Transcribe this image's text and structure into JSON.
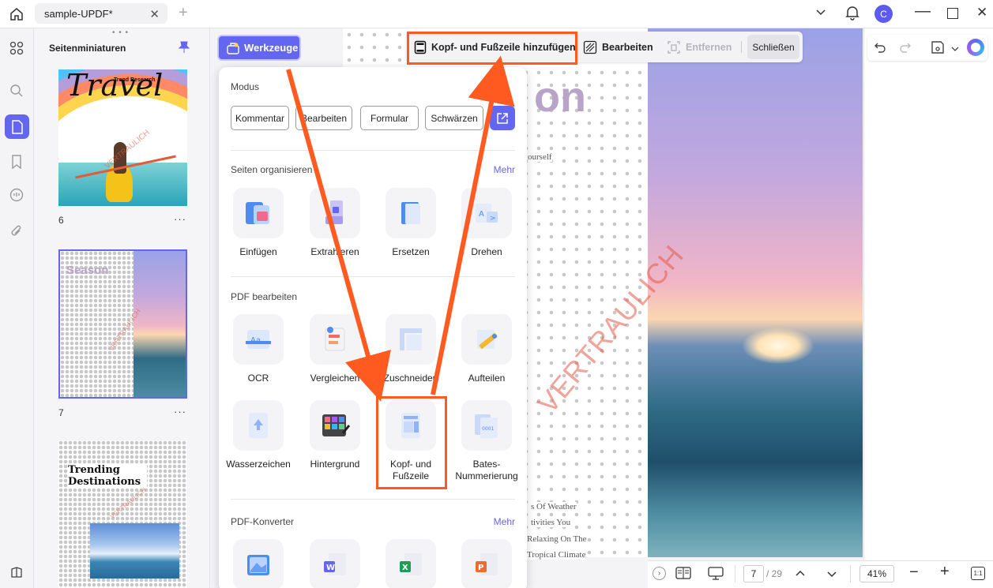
{
  "tab": {
    "title": "sample-UPDF*"
  },
  "user": {
    "initial": "C"
  },
  "thumbnail_panel": {
    "title": "Seitenminiaturen",
    "pages": [
      {
        "number": "6",
        "heading": "Travel",
        "subheading": "Trend Research",
        "watermark": "VERTRAULICH"
      },
      {
        "number": "7",
        "heading": "Season",
        "watermark": "VERTRAULICH"
      },
      {
        "number": "",
        "heading": "Trending Destinations",
        "watermark": "VERTRAULICH"
      }
    ],
    "more": "···"
  },
  "toolbar": {
    "werkzeuge": "Werkzeuge",
    "add_header_footer": "Kopf- und Fußzeile hinzufügen",
    "edit": "Bearbeiten",
    "remove": "Entfernen",
    "close": "Schließen"
  },
  "tools_menu": {
    "mode_label": "Modus",
    "modes": [
      "Kommentar",
      "Bearbeiten",
      "Formular",
      "Schwärzen"
    ],
    "sections": {
      "organize": {
        "label": "Seiten organisieren",
        "more": "Mehr"
      },
      "edit": {
        "label": "PDF bearbeiten"
      },
      "converter": {
        "label": "PDF-Konverter",
        "more": "Mehr"
      }
    },
    "organize_tools": [
      "Einfügen",
      "Extrahieren",
      "Ersetzen",
      "Drehen"
    ],
    "edit_tools_row1": [
      "OCR",
      "Vergleichen",
      "Zuschneiden",
      "Aufteilen"
    ],
    "edit_tools_row2": [
      "Wasserzeichen",
      "Hintergrund",
      "Kopf- und Fußzeile",
      "Bates-Nummerierung"
    ]
  },
  "document": {
    "title_fragment": "on",
    "text_fragment": "ourself",
    "watermark": "VERTRAULICH",
    "bottom_lines": [
      "s Of Weather",
      "tivities You",
      "Relaxing On The",
      "Tropical Climate"
    ]
  },
  "statusbar": {
    "current_page": "7",
    "total_pages": "/ 29",
    "zoom": "41%"
  },
  "colors": {
    "accent": "#6366f1",
    "highlight": "#ff5a1f",
    "watermark": "#e65a46"
  }
}
